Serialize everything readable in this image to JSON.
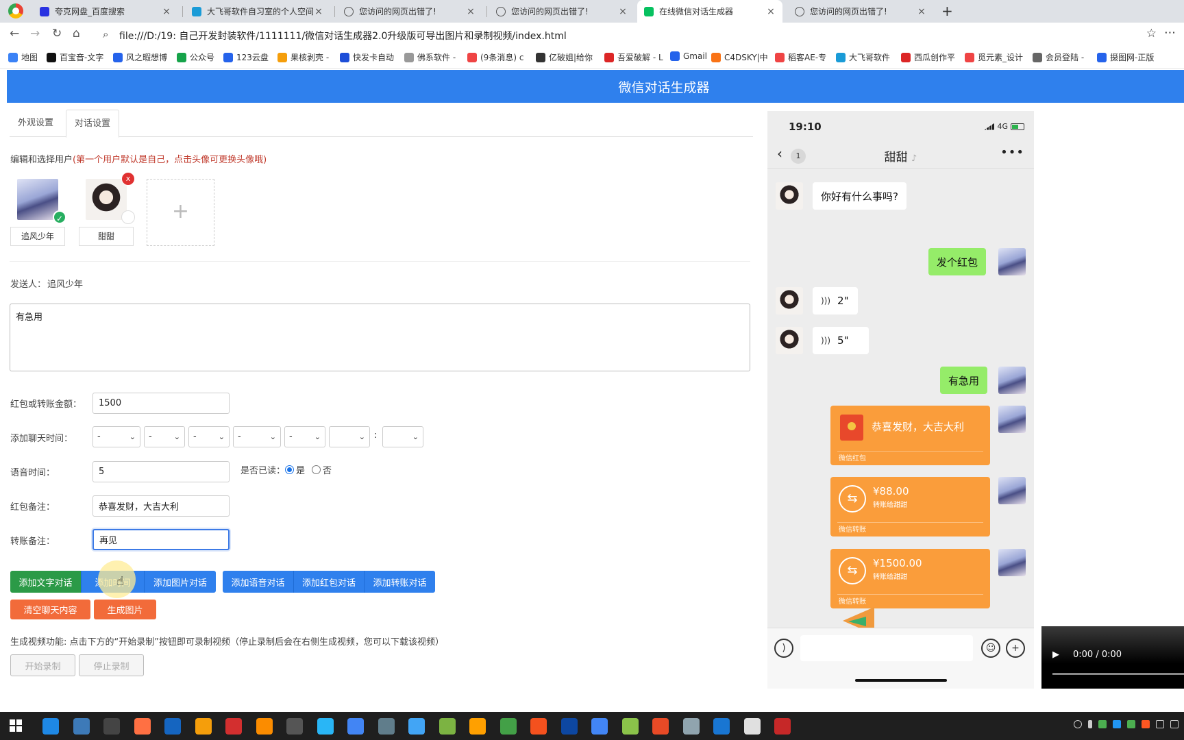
{
  "browser": {
    "tabs": [
      {
        "label": "夸克网盘_百度搜索",
        "icon": "baidu-paw-icon",
        "color": "#2932e1"
      },
      {
        "label": "大飞哥软件自习室的个人空间",
        "icon": "bilibili-tv-icon",
        "color": "#1a9bd7"
      },
      {
        "label": "您访问的网页出错了!",
        "icon": "globe-icon",
        "color": "#555555"
      },
      {
        "label": "您访问的网页出错了!",
        "icon": "globe-icon",
        "color": "#555555"
      },
      {
        "label": "在线微信对话生成器",
        "icon": "wechat-icon",
        "color": "#07c160"
      },
      {
        "label": "您访问的网页出错了!",
        "icon": "globe-icon",
        "color": "#555555"
      }
    ],
    "address": "file:///D:/19:  自己开发封装软件/1111111/微信对话生成器2.0升级版可导出图片和录制视频/index.html",
    "bookmarks": [
      "地图",
      "百宝音-文字",
      "风之暇想博",
      "公众号",
      "123云盘",
      "果核剥壳 -",
      "快发卡自动",
      "佛系软件 -",
      "(9条消息) c",
      "亿破姐|给你",
      "吾爱破解 - L",
      "Gmail",
      "C4DSKY|中",
      "稻客AE-专",
      "大飞哥软件",
      "西瓜创作平",
      "觅元素_设计",
      "会员登陆 -",
      "摄图网-正版"
    ]
  },
  "page": {
    "title": "微信对话生成器",
    "tabs": [
      "外观设置",
      "对话设置"
    ],
    "users_label": "编辑和选择用户",
    "users_hint": "(第一个用户默认是自己，点击头像可更换头像哦)",
    "users": [
      {
        "name": "追风少年",
        "selected": true
      },
      {
        "name": "甜甜",
        "selected": false
      }
    ],
    "add_user": "+",
    "sender_label": "发送人：",
    "sender_name": "追风少年",
    "message_text": "有急用",
    "fields": {
      "amount_label": "红包或转账金额：",
      "amount_value": "1500",
      "time_label": "添加聊天时间：",
      "time_selects": [
        "-",
        "-",
        "-",
        "-",
        "-",
        "",
        ""
      ],
      "time_colon": ":",
      "voice_label": "语音时间：",
      "voice_value": "5",
      "read_label": "是否已读：",
      "read_yes": "是",
      "read_no": "否",
      "redpkt_note_label": "红包备注：",
      "redpkt_note_value": "恭喜发财，大吉大利",
      "transfer_note_label": "转账备注：",
      "transfer_note_value": "再见"
    },
    "buttons": {
      "add_text": "添加文字对话",
      "add_time": "添加时间",
      "add_image": "添加图片对话",
      "add_voice": "添加语音对话",
      "add_redpkt": "添加红包对话",
      "add_transfer": "添加转账对话",
      "clear": "清空聊天内容",
      "gen_image": "生成图片",
      "start_rec": "开始录制",
      "stop_rec": "停止录制"
    },
    "video_note": "生成视频功能: 点击下方的“开始录制”按钮即可录制视频（停止录制后会在右侧生成视频，您可以下载该视频）"
  },
  "phone": {
    "time": "19:10",
    "network": "4G",
    "unread": "1",
    "contact": "甜甜",
    "messages": {
      "m1": "你好有什么事吗?",
      "m2": "发个红包",
      "m3": "2\"",
      "m4": "5\"",
      "m5": "有急用",
      "redpkt_text": "恭喜发财，大吉大利",
      "redpkt_foot": "微信红包",
      "xfer1_amount": "¥88.00",
      "xfer1_to": "转账给甜甜",
      "xfer1_foot": "微信转账",
      "xfer2_amount": "¥1500.00",
      "xfer2_to": "转账给甜甜",
      "xfer2_foot": "微信转账"
    }
  },
  "video": {
    "time": "0:00 / 0:00"
  },
  "colors": {
    "header": "#2f80ed",
    "green_btn": "#2b9a47",
    "orange_btn": "#f26b3a",
    "wechat_green": "#95ec69",
    "transfer_orange": "#fa9d3b"
  }
}
